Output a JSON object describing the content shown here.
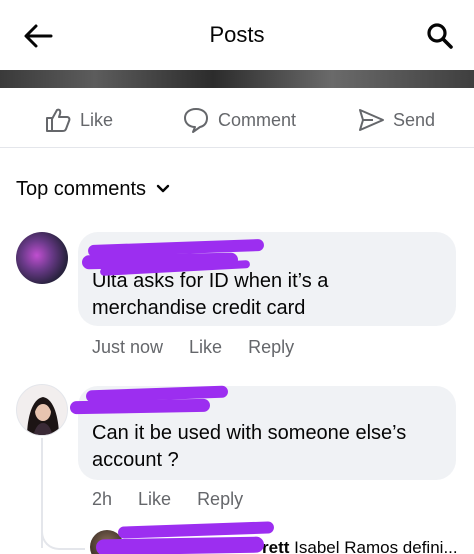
{
  "header": {
    "title": "Posts"
  },
  "actions": {
    "like_label": "Like",
    "comment_label": "Comment",
    "send_label": "Send"
  },
  "sort": {
    "label": "Top comments"
  },
  "comments": [
    {
      "text": "Ulta asks for ID when it’s a merchandise credit card",
      "line1": "Ulta asks for ID when it’s a",
      "line2": "merchandise credit card",
      "time": "Just now",
      "like_label": "Like",
      "reply_label": "Reply"
    },
    {
      "text": "Can it be used with someone else’s account ?",
      "line1": "Can it be used with someone else’s",
      "line2": "account ?",
      "time": "2h",
      "like_label": "Like",
      "reply_label": "Reply"
    }
  ],
  "reply_preview": {
    "name_fragment": "rett",
    "text": "Isabel Ramos defini..."
  },
  "colors": {
    "bubble": "#f0f2f5",
    "secondary_text": "#65676b",
    "redaction": "#9c2ef0"
  }
}
